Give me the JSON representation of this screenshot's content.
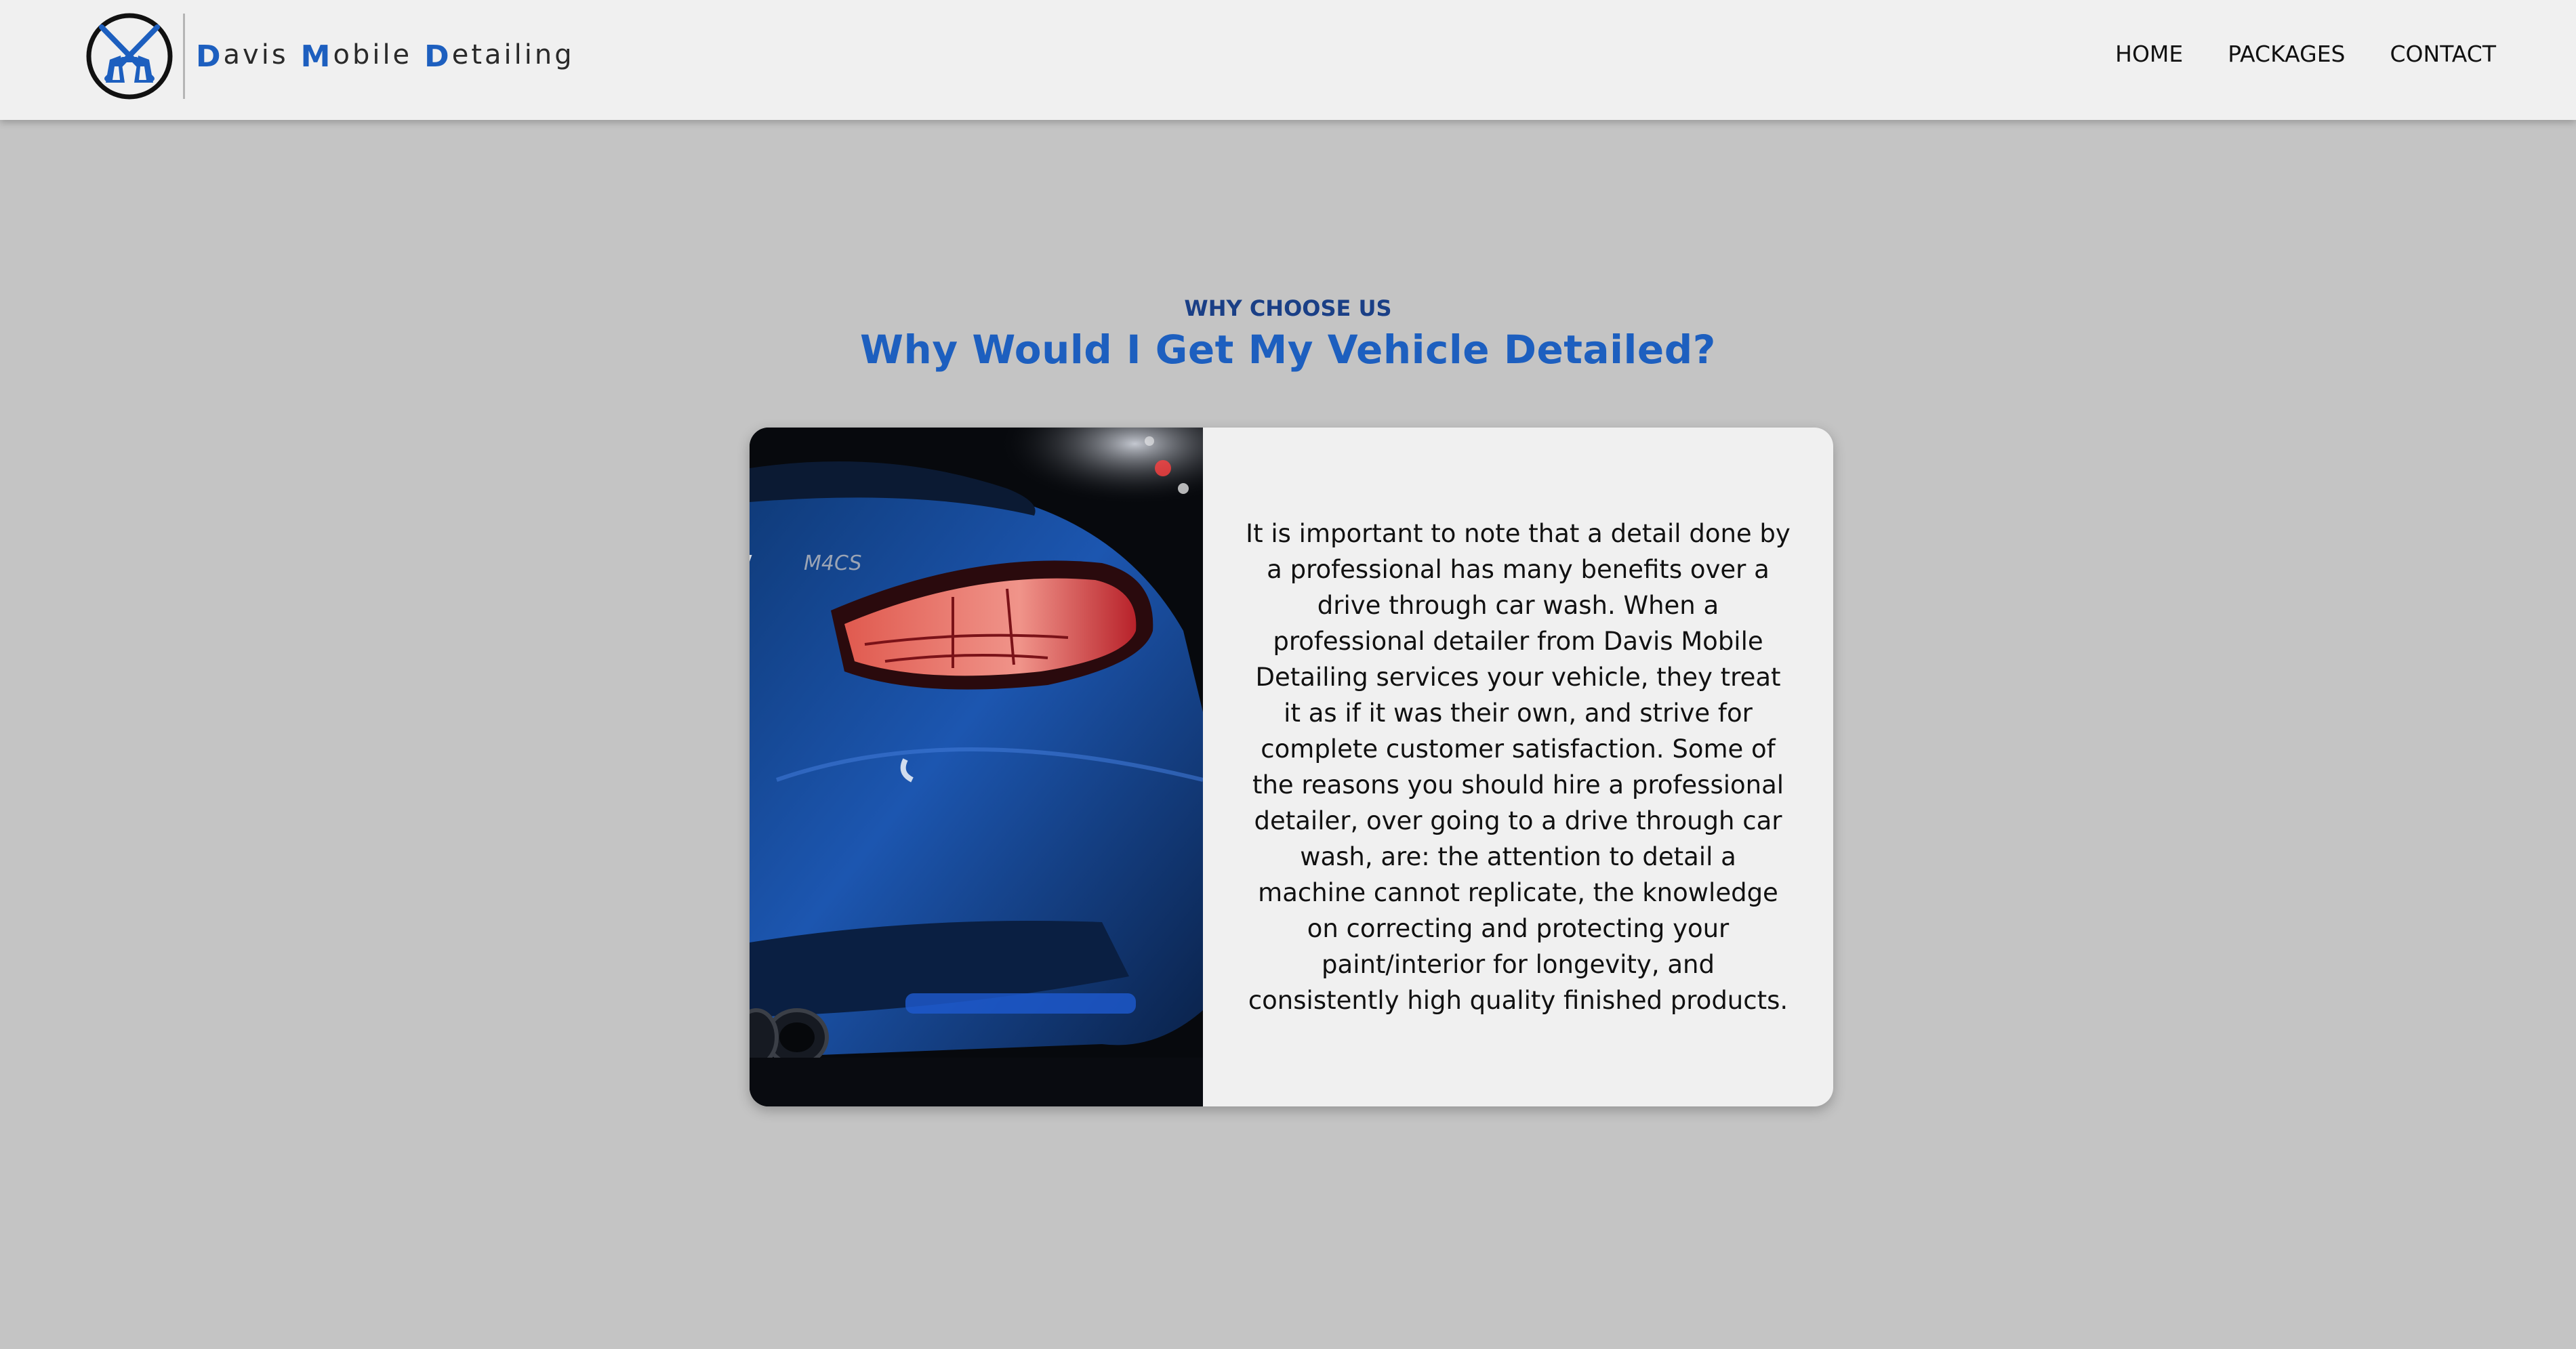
{
  "header": {
    "brand": {
      "words": [
        {
          "initial": "D",
          "rest": "avis"
        },
        {
          "initial": "M",
          "rest": "obile"
        },
        {
          "initial": "D",
          "rest": "etailing"
        }
      ],
      "logo_icon": "crossed-spray-guns-logo-icon"
    },
    "nav": {
      "home": "HOME",
      "packages": "PACKAGES",
      "contact": "CONTACT"
    }
  },
  "section": {
    "eyebrow": "WHY CHOOSE US",
    "title": "Why Would I Get My Vehicle Detailed?",
    "card": {
      "image_alt": "rear-car-taillight-photo",
      "body": "It is important to note that a detail done by a professional has many benefits over a drive through car wash. When a professional detailer from Davis Mobile Detailing services your vehicle, they treat it as if it was their own, and strive for complete customer satisfaction. Some of the reasons you should hire a professional detailer, over going to a drive through car wash, are: the attention to detail a machine cannot replicate, the knowledge on correcting and protecting your paint/interior for longevity, and consistently high quality finished products."
    }
  },
  "colors": {
    "page_background": "#c4c4c4",
    "header_background": "#f0f0f0",
    "brand_blue": "#1d5fbf",
    "eyebrow_blue": "#1a3f86",
    "card_background": "#f0f0f0"
  }
}
